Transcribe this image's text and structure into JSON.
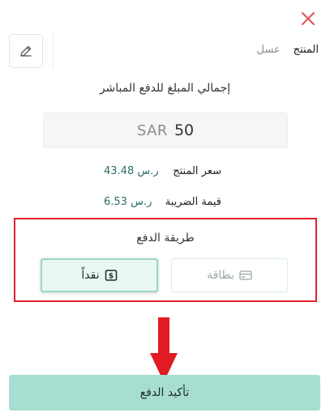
{
  "header": {
    "product_label": "المنتج",
    "product_value": "عسل"
  },
  "total": {
    "title": "إجمالي المبلغ للدفع المباشر",
    "currency": "SAR",
    "amount": "50"
  },
  "details": {
    "price_label": "سعر المنتج",
    "price_value": "43.48 ر.س",
    "tax_label": "قيمة الضريبة",
    "tax_value": "6.53 ر.س"
  },
  "payment_method": {
    "title": "طريقة الدفع",
    "card_label": "بطاقة",
    "cash_label": "نقداً",
    "selected": "cash"
  },
  "confirm": {
    "label": "تأكيد الدفع"
  },
  "icons": {
    "close": "close-icon",
    "edit": "pencil-icon",
    "card": "credit-card-icon",
    "cash": "cash-icon",
    "arrow": "arrow-down-icon"
  },
  "colors": {
    "close": "#e05a5a",
    "highlight_border": "#e0212b",
    "arrow": "#e01b24",
    "accent": "#a8ddd2",
    "value_text": "#2c6e6a"
  }
}
